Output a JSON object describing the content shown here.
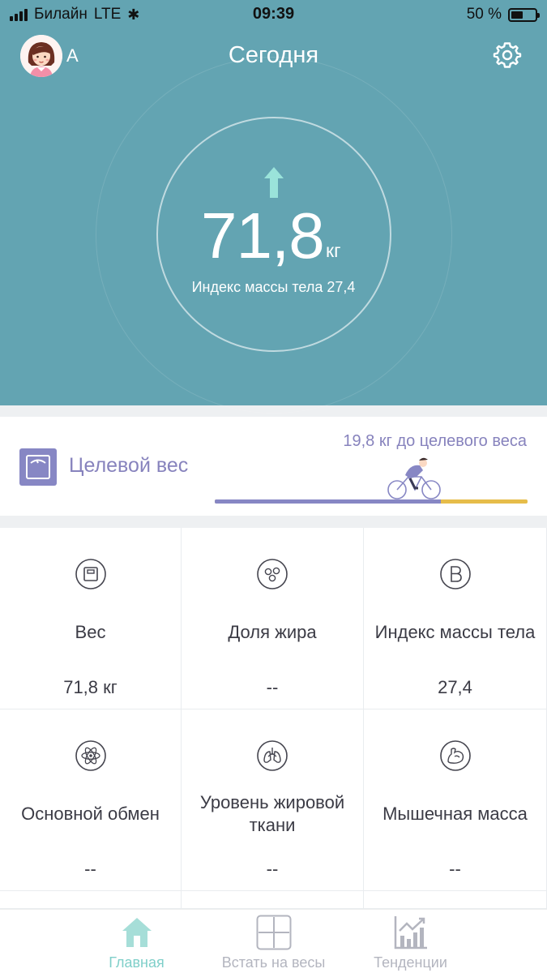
{
  "status_bar": {
    "carrier": "Билайн",
    "network": "LTE",
    "time": "09:39",
    "battery": "50 %",
    "battery_level": 0.5
  },
  "header": {
    "user_initial": "A",
    "title": "Сегодня"
  },
  "hero": {
    "trend": "up",
    "weight_value": "71,8",
    "weight_unit": "кг",
    "bmi_text": "Индекс массы тела 27,4"
  },
  "target": {
    "label": "Целевой вес",
    "remaining": "19,8 кг до целевого веса",
    "progress": 0.724
  },
  "metrics": [
    {
      "icon": "scale-icon",
      "name": "Вес",
      "value": "71,8 кг"
    },
    {
      "icon": "fat-cells-icon",
      "name": "Доля жира",
      "value": "--"
    },
    {
      "icon": "bmi-b-icon",
      "name": "Индекс массы тела",
      "value": "27,4"
    },
    {
      "icon": "atom-icon",
      "name": "Основной обмен",
      "value": "--"
    },
    {
      "icon": "lungs-icon",
      "name": "Уровень жировой ткани",
      "value": "--"
    },
    {
      "icon": "muscle-icon",
      "name": "Мышечная масса",
      "value": "--"
    }
  ],
  "tabs": [
    {
      "icon": "home-icon",
      "label": "Главная",
      "active": true
    },
    {
      "icon": "weigh-icon",
      "label": "Встать на весы",
      "active": false
    },
    {
      "icon": "trends-icon",
      "label": "Тенденции",
      "active": false
    }
  ],
  "colors": {
    "hero_bg": "#63a4b2",
    "accent_purple": "#8787c4",
    "accent_yellow": "#e6bd4a",
    "active_tab": "#7fcfc9"
  }
}
